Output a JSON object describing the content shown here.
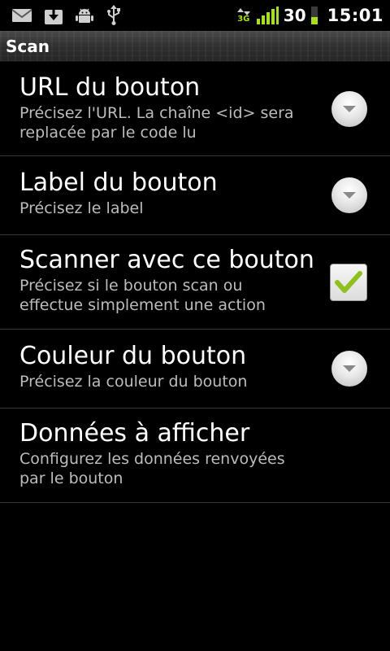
{
  "status_bar": {
    "network_type": "3G",
    "battery_level": "30",
    "time": "15:01",
    "icons": [
      "gmail-icon",
      "download-icon",
      "android-debug-icon",
      "usb-icon",
      "data-activity-icon",
      "signal-icon",
      "battery-icon"
    ],
    "colors": {
      "signal": "#a8e010",
      "battery": "#a8e010"
    }
  },
  "title_bar": {
    "title": "Scan"
  },
  "preferences": [
    {
      "title": "URL du bouton",
      "summary": "Précisez l'URL. La chaîne <id> sera replacée par le code lu",
      "widget": "dropdown"
    },
    {
      "title": "Label du bouton",
      "summary": "Précisez le label",
      "widget": "dropdown"
    },
    {
      "title": "Scanner avec ce bouton",
      "summary": "Précisez si le bouton scan ou effectue simplement une action",
      "widget": "checkbox",
      "checked": true
    },
    {
      "title": "Couleur du bouton",
      "summary": "Précisez la couleur du bouton",
      "widget": "dropdown"
    },
    {
      "title": "Données à afficher",
      "summary": "Configurez les données renvoyées par le bouton",
      "widget": "none"
    }
  ],
  "colors": {
    "background": "#000000",
    "divider": "#3a3a3a",
    "summary_text": "#bcbcbc",
    "check_mark": "#8cc21a"
  }
}
